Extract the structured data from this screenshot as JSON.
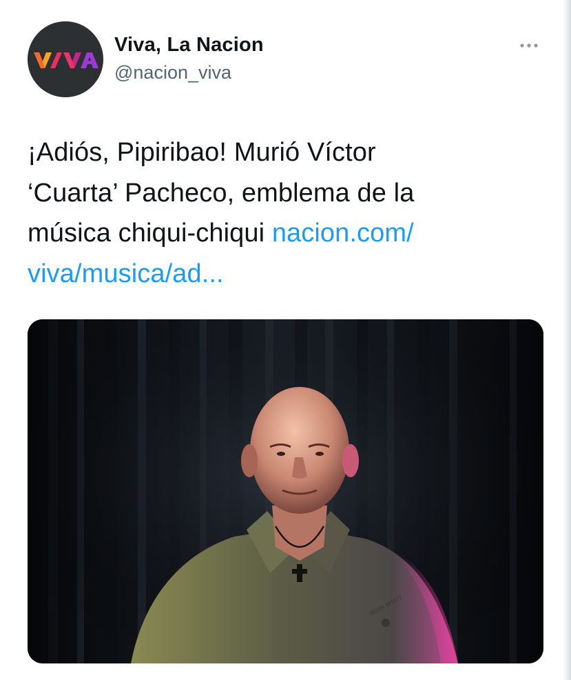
{
  "account": {
    "display_name": "Viva, La Nacion",
    "handle": "@nacion_viva",
    "avatar_logo_text": "VIVA"
  },
  "tweet": {
    "text_line_1": "¡Adiós, Pipiribao! Murió Víctor",
    "text_line_2": "‘Cuarta’ Pacheco, emblema de la",
    "text_line_3_plain": "música chiqui-chiqui ",
    "link_part_1": "nacion.com/",
    "link_part_2": "viva/musica/ad..."
  },
  "media": {
    "shirt_print_text": "IRISH SPIRIT"
  },
  "icons": {
    "more": "more-horizontal-icon",
    "avatar": "viva-logo-icon"
  },
  "colors": {
    "link": "#1d9bf0",
    "text": "#0f1419",
    "secondary_text": "#536471",
    "avatar_bg": "#2d3033"
  }
}
